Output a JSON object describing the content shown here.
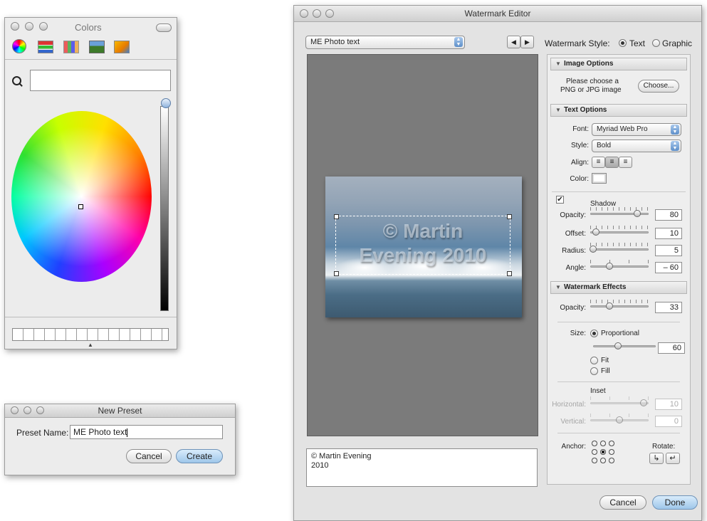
{
  "colors_panel": {
    "title": "Colors",
    "mode_icons": [
      "color-wheel-icon",
      "color-sliders-icon",
      "color-palettes-icon",
      "image-palettes-icon",
      "crayons-icon"
    ]
  },
  "new_preset": {
    "title": "New Preset",
    "name_label": "Preset Name:",
    "name_value": "ME Photo text",
    "cancel_label": "Cancel",
    "create_label": "Create"
  },
  "watermark_editor": {
    "title": "Watermark Editor",
    "preset_select": "ME Photo text",
    "style_label": "Watermark Style:",
    "style_text": "Text",
    "style_graphic": "Graphic",
    "style_selected": "Text",
    "watermark_text_preview": "© Martin Evening 2010",
    "text_field": [
      "© Martin Evening",
      "2010"
    ],
    "image_options": {
      "header": "Image Options",
      "prompt": [
        "Please choose a",
        "PNG or JPG image"
      ],
      "choose_label": "Choose..."
    },
    "text_options": {
      "header": "Text Options",
      "font_label": "Font:",
      "font_value": "Myriad Web Pro",
      "style_label": "Style:",
      "style_value": "Bold",
      "align_label": "Align:",
      "color_label": "Color:"
    },
    "shadow": {
      "label": "Shadow",
      "enabled": true,
      "opacity_label": "Opacity:",
      "opacity": "80",
      "offset_label": "Offset:",
      "offset": "10",
      "radius_label": "Radius:",
      "radius": "5",
      "angle_label": "Angle:",
      "angle": "– 60"
    },
    "effects": {
      "header": "Watermark Effects",
      "opacity_label": "Opacity:",
      "opacity": "33",
      "size_label": "Size:",
      "size_proportional": "Proportional",
      "size_value": "60",
      "size_fit": "Fit",
      "size_fill": "Fill",
      "inset_label": "Inset",
      "horizontal_label": "Horizontal:",
      "horizontal_value": "10",
      "vertical_label": "Vertical:",
      "vertical_value": "0",
      "anchor_label": "Anchor:",
      "rotate_label": "Rotate:"
    },
    "cancel_label": "Cancel",
    "done_label": "Done"
  }
}
